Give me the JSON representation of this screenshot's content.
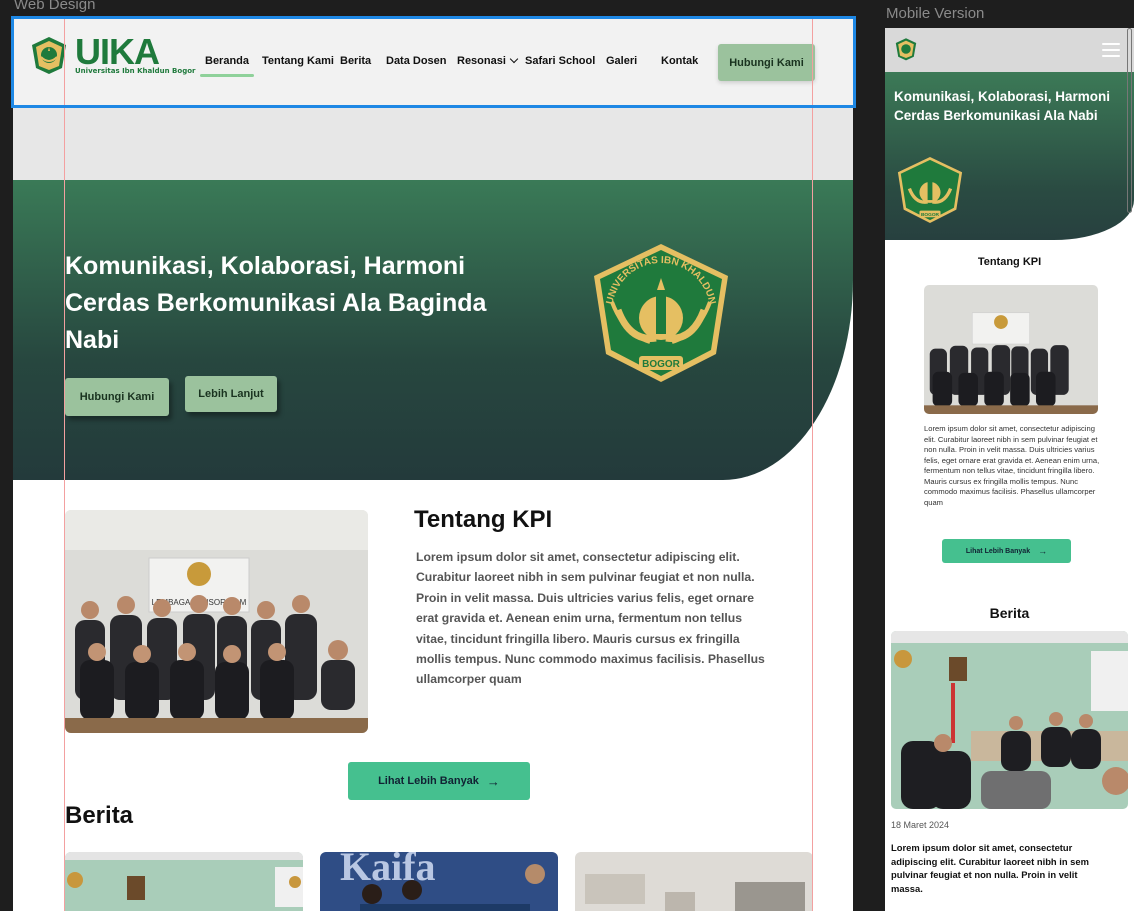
{
  "canvas": {
    "web_label": "Web Design",
    "mobile_label": "Mobile Version"
  },
  "web": {
    "brand": {
      "name": "UIKA",
      "subtitle": "Universitas Ibn Khaldun Bogor"
    },
    "nav": {
      "items": [
        {
          "label": "Beranda",
          "active": true
        },
        {
          "label": "Tentang Kami"
        },
        {
          "label": "Berita"
        },
        {
          "label": "Data Dosen"
        },
        {
          "label": "Resonasi",
          "has_dropdown": true
        },
        {
          "label": "Safari School"
        },
        {
          "label": "Galeri"
        },
        {
          "label": "Kontak"
        }
      ],
      "cta_label": "Hubungi Kami"
    },
    "hero": {
      "title": "Komunikasi, Kolaborasi, Harmoni Cerdas Berkomunikasi Ala Baginda Nabi",
      "primary_button": "Hubungi Kami",
      "secondary_button": "Lebih Lanjut",
      "seal_top_text": "UNIVERSITAS IBN KHALDUN",
      "seal_bottom_text": "BOGOR"
    },
    "about": {
      "title": "Tentang KPI",
      "body": "Lorem ipsum dolor sit amet, consectetur adipiscing elit. Curabitur laoreet nibh in sem pulvinar feugiat et non nulla. Proin in velit massa. Duis ultricies varius felis, eget ornare erat gravida et. Aenean enim urna, fermentum non tellus vitae, tincidunt fringilla libero. Mauris cursus ex fringilla mollis tempus. Nunc commodo maximus facilisis. Phasellus ullamcorper quam",
      "photo_sign": "LEMBAGA SENSOR FILM",
      "more_button": "Lihat Lebih Banyak"
    },
    "news": {
      "title": "Berita",
      "card_2_overlay": "Kaifa"
    }
  },
  "mobile": {
    "hero": {
      "title": "Komunikasi, Kolaborasi, Harmoni Cerdas Berkomunikasi Ala Nabi",
      "seal_bottom_text": "BOGOR"
    },
    "about": {
      "title": "Tentang KPI",
      "body": "Lorem ipsum dolor sit amet, consectetur adipiscing elit. Curabitur laoreet nibh in sem pulvinar feugiat et non nulla. Proin in velit massa. Duis ultricies varius felis, eget ornare erat gravida et. Aenean enim urna, fermentum non tellus vitae, tincidunt fringilla libero. Mauris cursus ex fringilla mollis tempus. Nunc commodo maximus facilisis. Phasellus ullamcorper quam",
      "more_button": "Lihat Lebih Banyak"
    },
    "news": {
      "title": "Berita",
      "date": "18 Maret 2024",
      "body": "Lorem ipsum dolor sit amet, consectetur adipiscing elit. Curabitur laoreet nibh in sem pulvinar feugiat et non nulla. Proin in velit massa."
    }
  },
  "colors": {
    "brand_green": "#1f7a3c",
    "cta_green": "#9bc29d",
    "accent_green": "#45c08f",
    "hero_top": "#3a7a57",
    "hero_bottom": "#233a3b",
    "seal_gold": "#e5bf62"
  },
  "icons": [
    "uika-logo-icon",
    "chevron-down-icon",
    "arrow-right-icon",
    "hamburger-menu-icon",
    "university-seal-icon"
  ]
}
